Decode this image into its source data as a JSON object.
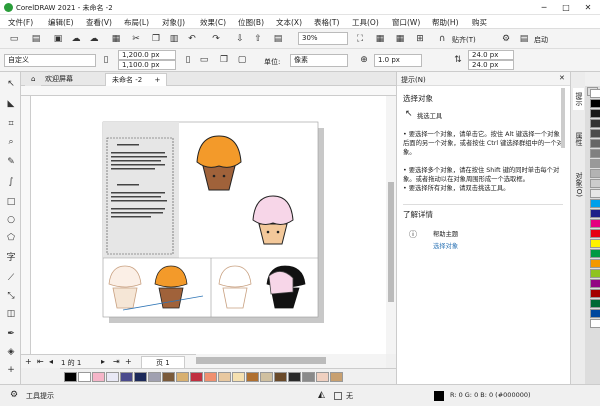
{
  "app": {
    "title": "CorelDRAW 2021 - 未命名 -2",
    "min": "─",
    "max": "□",
    "close": "✕"
  },
  "menu": [
    "文件(F)",
    "编辑(E)",
    "查看(V)",
    "布局(L)",
    "对象(J)",
    "效果(C)",
    "位图(B)",
    "文本(X)",
    "表格(T)",
    "工具(O)",
    "窗口(W)",
    "帮助(H)",
    "购买"
  ],
  "toolbar": {
    "zoom": "30%",
    "snap": "贴齐(T)",
    "launch": "启动"
  },
  "propbar": {
    "preset": "自定义",
    "width": "1,200.0 px",
    "height": "1,100.0 px",
    "units_label": "单位:",
    "units": "像素",
    "nudge": "1.0 px",
    "dup_x": "24.0 px",
    "dup_y": "24.0 px"
  },
  "tabs": [
    {
      "label": "欢迎屏幕"
    },
    {
      "label": "未命名 -2"
    }
  ],
  "pagenav": {
    "pages": "1 的 1",
    "page_tab": "页 1"
  },
  "docker": {
    "header": "提示(N)",
    "heading": "选择对象",
    "tool_name": "挑选工具",
    "tips": [
      "要选择一个对象，请单击它。按住 Alt 键选择一个对象后面的另一个对象，或者按住 Ctrl 键选择群组中的一个对象。",
      "要选择多个对象，请在按住 Shift 键的同时单击每个对象。或者拖动以在对象周围形成一个选取框。",
      "要选择所有对象，请双击挑选工具。"
    ],
    "more_heading": "了解详情",
    "help_title": "帮助主题",
    "help_link": "选择对象"
  },
  "right_tabs": [
    "提示",
    "属性",
    "对象(O)"
  ],
  "status": {
    "tool_hint": "工具提示",
    "fill_none": "无",
    "fill_info": "R: 0 G: 0 B: 0 (#000000)"
  },
  "colors": {
    "accent": "#2e75b6",
    "cupcake_orange": "#f39a2a",
    "cupcake_pink": "#f7d6e8",
    "cupcake_brown": "#a0623a"
  },
  "palette_v": [
    "#ffffff",
    "#000000",
    "#1a1a1a",
    "#333333",
    "#4d4d4d",
    "#666666",
    "#808080",
    "#999999",
    "#b3b3b3",
    "#cccccc",
    "#e6e6e6",
    "#00a0e9",
    "#1d2088",
    "#e4007f",
    "#e60012",
    "#fff100",
    "#009944",
    "#f39800",
    "#8fc31f",
    "#920783",
    "#a40000",
    "#006934",
    "#00479d",
    "#ffffff"
  ],
  "palette_h": [
    "#000000",
    "#ffffff",
    "#f5b5c8",
    "#e8e8f5",
    "#4a4a8c",
    "#1d2a5a",
    "#a0a0b0",
    "#7a5a3a",
    "#d8b070",
    "#c03040",
    "#f09070",
    "#e8c8a0",
    "#f5e0b0",
    "#b07030",
    "#d0c0a0",
    "#6a4a2a",
    "#2a2a2a",
    "#8a8a8a",
    "#f0d0c0",
    "#c8a070"
  ]
}
